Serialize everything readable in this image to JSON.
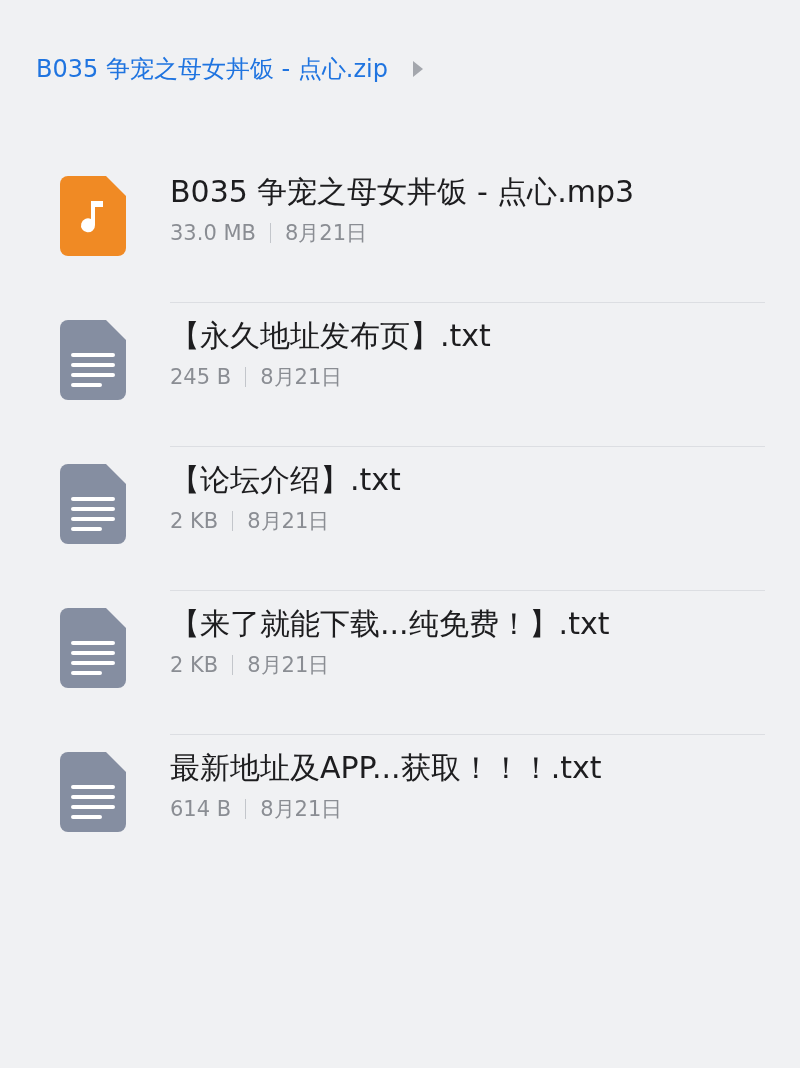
{
  "breadcrumb": {
    "path": "B035 争宠之母女丼饭 - 点心.zip"
  },
  "files": [
    {
      "kind": "audio",
      "name": "B035 争宠之母女丼饭 - 点心.mp3",
      "size": "33.0 MB",
      "date": "8月21日"
    },
    {
      "kind": "text",
      "name": "【永久地址发布页】.txt",
      "size": "245 B",
      "date": "8月21日"
    },
    {
      "kind": "text",
      "name": "【论坛介绍】.txt",
      "size": "2 KB",
      "date": "8月21日"
    },
    {
      "kind": "text",
      "name": "【来了就能下载...纯免费！】.txt",
      "size": "2 KB",
      "date": "8月21日"
    },
    {
      "kind": "text",
      "name": "最新地址及APP...获取！！！.txt",
      "size": "614 B",
      "date": "8月21日"
    }
  ]
}
